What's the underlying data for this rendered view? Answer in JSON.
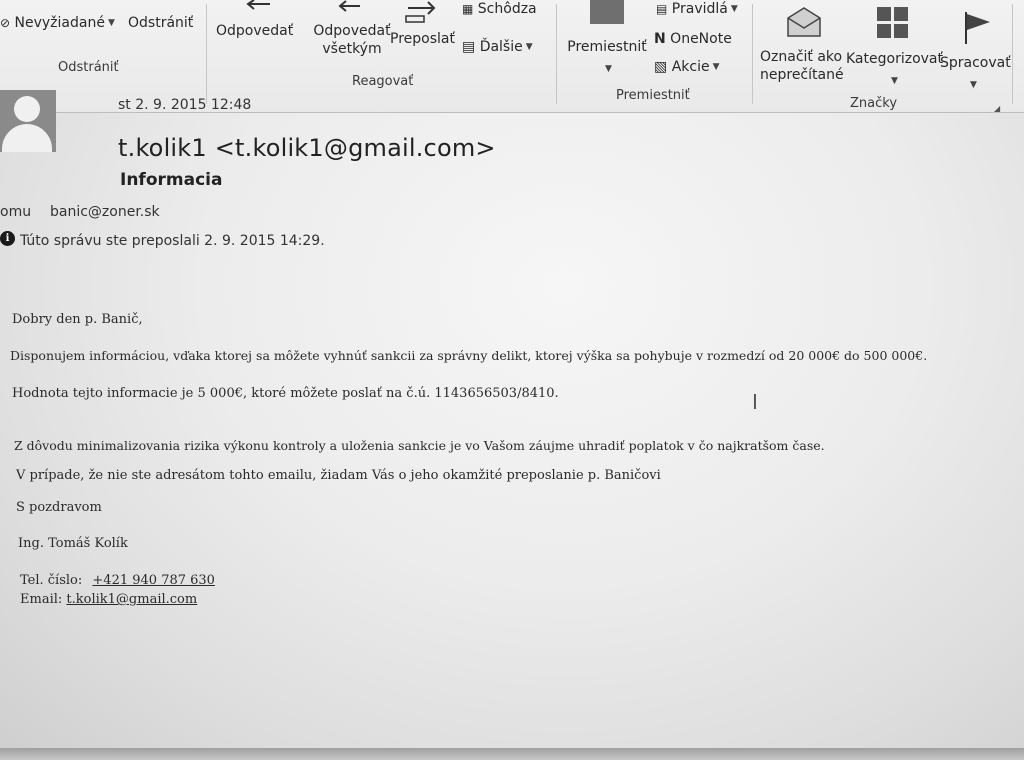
{
  "ribbon": {
    "delete_group": {
      "junk_label": "Nevyžiadané",
      "delete_label": "Odstrániť",
      "group_label": "Odstrániť"
    },
    "respond_group": {
      "reply_label": "Odpovedať",
      "reply_all_line1": "Odpovedať",
      "reply_all_line2": "všetkým",
      "forward_label": "Preposlať",
      "meeting_label": "Schôdza",
      "more_label": "Ďalšie",
      "group_label": "Reagovať"
    },
    "move_group": {
      "move_label": "Premiestniť",
      "rules_label": "Pravidlá",
      "onenote_label": "OneNote",
      "actions_label": "Akcie",
      "group_label": "Premiestniť"
    },
    "tags_group": {
      "mark_unread_line1": "Označiť ako",
      "mark_unread_line2": "neprečítané",
      "categorize_label": "Kategorizovať",
      "followup_label": "Spracovať",
      "group_label": "Značky"
    }
  },
  "message": {
    "date": "st 2. 9. 2015 12:48",
    "sender": "t.kolik1 <t.kolik1@gmail.com>",
    "subject": "Informacia",
    "to_label": "omu",
    "to_value": "banic@zoner.sk",
    "forwarded_notice": "Túto správu ste preposlali 2. 9. 2015 14:29."
  },
  "body": {
    "greeting": "Dobry den p. Banič,",
    "p1": "Disponujem informáciou, vďaka ktorej sa môžete vyhnúť sankcii za správny delikt, ktorej výška sa pohybuje v rozmedzí od 20 000€ do 500 000€.",
    "p2": "Hodnota tejto informacie je 5 000€, ktoré môžete poslať na č.ú. 1143656503/8410.",
    "p3": "Z dôvodu minimalizovania rizika výkonu kontroly a uloženia sankcie je vo Vašom záujme uhradiť poplatok v čo najkratšom čase.",
    "p4": "V prípade, že nie ste adresátom tohto emailu, žiadam Vás o jeho okamžité preposlanie p. Baničovi",
    "closing": "S pozdravom",
    "signature": "Ing. Tomáš Kolík",
    "phone_label": "Tel. číslo:",
    "phone_value": "+421 940 787 630",
    "email_label": "Email:",
    "email_value": "t.kolik1@gmail.com"
  }
}
